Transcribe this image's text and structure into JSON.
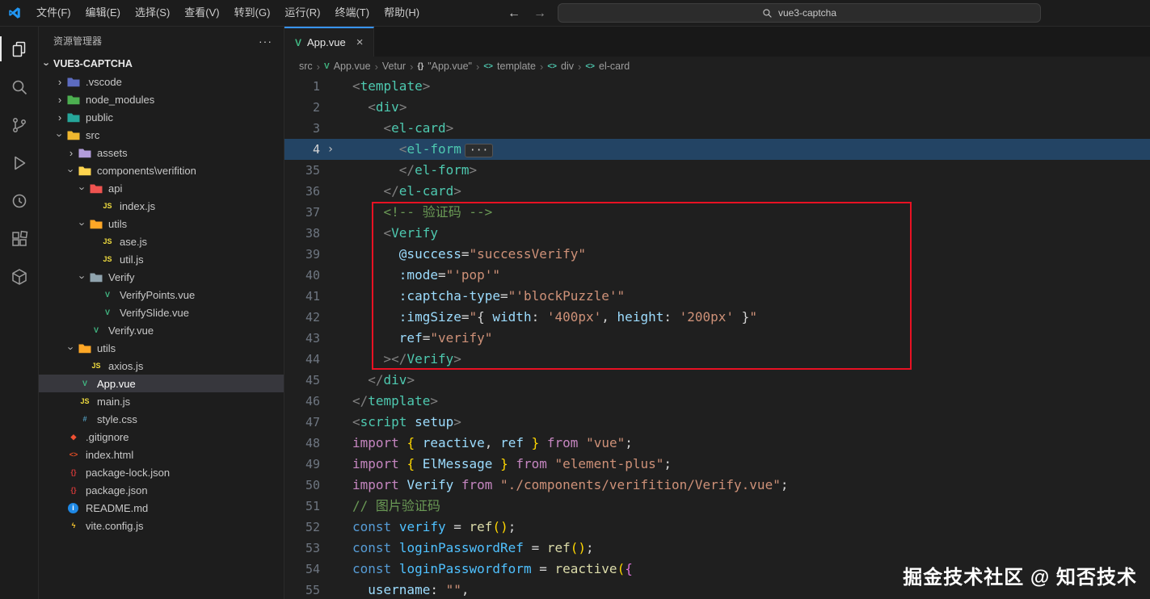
{
  "title_bar": {
    "menus": [
      "文件(F)",
      "编辑(E)",
      "选择(S)",
      "查看(V)",
      "转到(G)",
      "运行(R)",
      "终端(T)",
      "帮助(H)"
    ],
    "back_arrow": "←",
    "forward_arrow": "→",
    "search": {
      "value": "vue3-captcha"
    }
  },
  "activity_bar": {
    "items": [
      "explorer",
      "search",
      "source-control",
      "run-and-debug",
      "remote-explorer",
      "extensions",
      "container"
    ]
  },
  "sidebar": {
    "header": {
      "title": "资源管理器",
      "more": "···"
    },
    "root": {
      "label": "VUE3-CAPTCHA"
    },
    "tree": [
      {
        "label": ".vscode",
        "depth": 1,
        "type": "folder",
        "state": "collapsed",
        "color": "#5c6bc0"
      },
      {
        "label": "node_modules",
        "depth": 1,
        "type": "folder",
        "state": "collapsed",
        "color": "#4caf50"
      },
      {
        "label": "public",
        "depth": 1,
        "type": "folder",
        "state": "collapsed",
        "color": "#26a69a"
      },
      {
        "label": "src",
        "depth": 1,
        "type": "folder",
        "state": "expanded",
        "color": "#f0b72f"
      },
      {
        "label": "assets",
        "depth": 2,
        "type": "folder",
        "state": "collapsed",
        "color": "#b39ddb"
      },
      {
        "label": "components\\verifition",
        "depth": 2,
        "type": "folder",
        "state": "expanded",
        "color": "#ffd54f"
      },
      {
        "label": "api",
        "depth": 3,
        "type": "folder",
        "state": "expanded",
        "color": "#ef5350"
      },
      {
        "label": "index.js",
        "depth": 4,
        "type": "file",
        "icon": {
          "name": "javascript",
          "glyph": "JS",
          "fg": "#f1dd3f"
        }
      },
      {
        "label": "utils",
        "depth": 3,
        "type": "folder",
        "state": "expanded",
        "color": "#ffa726"
      },
      {
        "label": "ase.js",
        "depth": 4,
        "type": "file",
        "icon": {
          "name": "javascript",
          "glyph": "JS",
          "fg": "#f1dd3f"
        }
      },
      {
        "label": "util.js",
        "depth": 4,
        "type": "file",
        "icon": {
          "name": "javascript",
          "glyph": "JS",
          "fg": "#f1dd3f"
        }
      },
      {
        "label": "Verify",
        "depth": 3,
        "type": "folder",
        "state": "expanded",
        "color": "#90a4ae"
      },
      {
        "label": "VerifyPoints.vue",
        "depth": 4,
        "type": "file",
        "icon": {
          "name": "vue",
          "glyph": "V",
          "fg": "#41b883"
        }
      },
      {
        "label": "VerifySlide.vue",
        "depth": 4,
        "type": "file",
        "icon": {
          "name": "vue",
          "glyph": "V",
          "fg": "#41b883"
        }
      },
      {
        "label": "Verify.vue",
        "depth": 3,
        "type": "file",
        "icon": {
          "name": "vue",
          "glyph": "V",
          "fg": "#41b883"
        }
      },
      {
        "label": "utils",
        "depth": 2,
        "type": "folder",
        "state": "expanded",
        "color": "#ffa726"
      },
      {
        "label": "axios.js",
        "depth": 3,
        "type": "file",
        "icon": {
          "name": "javascript",
          "glyph": "JS",
          "fg": "#f1dd3f"
        }
      },
      {
        "label": "App.vue",
        "depth": 2,
        "type": "file",
        "selected": true,
        "icon": {
          "name": "vue",
          "glyph": "V",
          "fg": "#41b883"
        }
      },
      {
        "label": "main.js",
        "depth": 2,
        "type": "file",
        "icon": {
          "name": "javascript",
          "glyph": "JS",
          "fg": "#f1dd3f"
        }
      },
      {
        "label": "style.css",
        "depth": 2,
        "type": "file",
        "icon": {
          "name": "css",
          "glyph": "#",
          "fg": "#519aba"
        }
      },
      {
        "label": ".gitignore",
        "depth": 1,
        "type": "file",
        "icon": {
          "name": "git",
          "glyph": "◆",
          "fg": "#f05133"
        }
      },
      {
        "label": "index.html",
        "depth": 1,
        "type": "file",
        "icon": {
          "name": "html",
          "glyph": "<>",
          "fg": "#e44d26"
        }
      },
      {
        "label": "package-lock.json",
        "depth": 1,
        "type": "file",
        "icon": {
          "name": "npm",
          "glyph": "{}",
          "fg": "#cb3837"
        }
      },
      {
        "label": "package.json",
        "depth": 1,
        "type": "file",
        "icon": {
          "name": "npm",
          "glyph": "{}",
          "fg": "#cb3837"
        }
      },
      {
        "label": "README.md",
        "depth": 1,
        "type": "file",
        "icon": {
          "name": "readme",
          "glyph": "i",
          "fg": "#ffffff",
          "bg": "#1e88e5"
        }
      },
      {
        "label": "vite.config.js",
        "depth": 1,
        "type": "file",
        "icon": {
          "name": "vite",
          "glyph": "ϟ",
          "fg": "#ffcb2d"
        }
      }
    ]
  },
  "editor": {
    "tab": {
      "label": "App.vue",
      "close": "×"
    },
    "breadcrumbs": [
      {
        "label": "src"
      },
      {
        "label": "App.vue",
        "icon": "vue"
      },
      {
        "label": "Vetur"
      },
      {
        "label": "\"App.vue\"",
        "icon": "braces"
      },
      {
        "label": "template",
        "icon": "tag"
      },
      {
        "label": "div",
        "icon": "tag"
      },
      {
        "label": "el-card",
        "icon": "tag"
      }
    ],
    "annotation_box": {
      "color": "#e81123"
    },
    "watermark": "掘金技术社区 @ 知否技术",
    "code": {
      "lines": [
        {
          "num": 1,
          "tokens": [
            [
              "brk",
              "<"
            ],
            [
              "tag",
              "template"
            ],
            [
              "brk",
              ">"
            ]
          ]
        },
        {
          "num": 2,
          "tokens": [
            [
              "txt",
              "  "
            ],
            [
              "brk",
              "<"
            ],
            [
              "tag",
              "div"
            ],
            [
              "brk",
              ">"
            ]
          ]
        },
        {
          "num": 3,
          "tokens": [
            [
              "txt",
              "    "
            ],
            [
              "brk",
              "<"
            ],
            [
              "tag",
              "el-card"
            ],
            [
              "brk",
              ">"
            ]
          ]
        },
        {
          "num": 4,
          "fold": true,
          "highlight": true,
          "tokens": [
            [
              "txt",
              "      "
            ],
            [
              "brk",
              "<"
            ],
            [
              "tag",
              "el-form"
            ],
            [
              "fold",
              "···"
            ]
          ]
        },
        {
          "num": 35,
          "tokens": [
            [
              "txt",
              "      "
            ],
            [
              "brk",
              "</"
            ],
            [
              "tag",
              "el-form"
            ],
            [
              "brk",
              ">"
            ]
          ]
        },
        {
          "num": 36,
          "tokens": [
            [
              "txt",
              "    "
            ],
            [
              "brk",
              "</"
            ],
            [
              "tag",
              "el-card"
            ],
            [
              "brk",
              ">"
            ]
          ]
        },
        {
          "num": 37,
          "tokens": [
            [
              "txt",
              "    "
            ],
            [
              "cmt",
              "<!-- 验证码 -->"
            ]
          ]
        },
        {
          "num": 38,
          "tokens": [
            [
              "txt",
              "    "
            ],
            [
              "brk",
              "<"
            ],
            [
              "tag",
              "Verify"
            ]
          ]
        },
        {
          "num": 39,
          "tokens": [
            [
              "txt",
              "      "
            ],
            [
              "attr",
              "@success"
            ],
            [
              "pun",
              "="
            ],
            [
              "str",
              "\"successVerify\""
            ]
          ]
        },
        {
          "num": 40,
          "tokens": [
            [
              "txt",
              "      "
            ],
            [
              "attr",
              ":mode"
            ],
            [
              "pun",
              "="
            ],
            [
              "str",
              "\"'pop'\""
            ]
          ]
        },
        {
          "num": 41,
          "tokens": [
            [
              "txt",
              "      "
            ],
            [
              "attr",
              ":captcha-type"
            ],
            [
              "pun",
              "="
            ],
            [
              "str",
              "\"'blockPuzzle'\""
            ]
          ]
        },
        {
          "num": 42,
          "tokens": [
            [
              "txt",
              "      "
            ],
            [
              "attr",
              ":imgSize"
            ],
            [
              "pun",
              "="
            ],
            [
              "str",
              "\""
            ],
            [
              "pun",
              "{ "
            ],
            [
              "var",
              "width"
            ],
            [
              "pun",
              ": "
            ],
            [
              "str",
              "'400px'"
            ],
            [
              "pun",
              ", "
            ],
            [
              "var",
              "height"
            ],
            [
              "pun",
              ": "
            ],
            [
              "str",
              "'200px'"
            ],
            [
              "pun",
              " }"
            ],
            [
              "str",
              "\""
            ]
          ]
        },
        {
          "num": 43,
          "tokens": [
            [
              "txt",
              "      "
            ],
            [
              "attr",
              "ref"
            ],
            [
              "pun",
              "="
            ],
            [
              "str",
              "\"verify\""
            ]
          ]
        },
        {
          "num": 44,
          "tokens": [
            [
              "txt",
              "    "
            ],
            [
              "brk",
              "></"
            ],
            [
              "tag",
              "Verify"
            ],
            [
              "brk",
              ">"
            ]
          ]
        },
        {
          "num": 45,
          "tokens": [
            [
              "txt",
              "  "
            ],
            [
              "brk",
              "</"
            ],
            [
              "tag",
              "div"
            ],
            [
              "brk",
              ">"
            ]
          ]
        },
        {
          "num": 46,
          "tokens": [
            [
              "brk",
              "</"
            ],
            [
              "tag",
              "template"
            ],
            [
              "brk",
              ">"
            ]
          ]
        },
        {
          "num": 47,
          "tokens": [
            [
              "brk",
              "<"
            ],
            [
              "tag",
              "script"
            ],
            [
              "txt",
              " "
            ],
            [
              "attr",
              "setup"
            ],
            [
              "brk",
              ">"
            ]
          ]
        },
        {
          "num": 48,
          "tokens": [
            [
              "kw",
              "import"
            ],
            [
              "txt",
              " "
            ],
            [
              "brace",
              "{"
            ],
            [
              "txt",
              " "
            ],
            [
              "var",
              "reactive"
            ],
            [
              "pun",
              ","
            ],
            [
              "txt",
              " "
            ],
            [
              "var",
              "ref"
            ],
            [
              "txt",
              " "
            ],
            [
              "brace",
              "}"
            ],
            [
              "txt",
              " "
            ],
            [
              "kw",
              "from"
            ],
            [
              "txt",
              " "
            ],
            [
              "str",
              "\"vue\""
            ],
            [
              "pun",
              ";"
            ]
          ]
        },
        {
          "num": 49,
          "tokens": [
            [
              "kw",
              "import"
            ],
            [
              "txt",
              " "
            ],
            [
              "brace",
              "{"
            ],
            [
              "txt",
              " "
            ],
            [
              "var",
              "ElMessage"
            ],
            [
              "txt",
              " "
            ],
            [
              "brace",
              "}"
            ],
            [
              "txt",
              " "
            ],
            [
              "kw",
              "from"
            ],
            [
              "txt",
              " "
            ],
            [
              "str",
              "\"element-plus\""
            ],
            [
              "pun",
              ";"
            ]
          ]
        },
        {
          "num": 50,
          "tokens": [
            [
              "kw",
              "import"
            ],
            [
              "txt",
              " "
            ],
            [
              "var",
              "Verify"
            ],
            [
              "txt",
              " "
            ],
            [
              "kw",
              "from"
            ],
            [
              "txt",
              " "
            ],
            [
              "str",
              "\"./components/verifition/Verify.vue\""
            ],
            [
              "pun",
              ";"
            ]
          ]
        },
        {
          "num": 51,
          "tokens": [
            [
              "cmt",
              "// 图片验证码"
            ]
          ]
        },
        {
          "num": 52,
          "tokens": [
            [
              "kw2",
              "const"
            ],
            [
              "txt",
              " "
            ],
            [
              "var2",
              "verify"
            ],
            [
              "txt",
              " "
            ],
            [
              "pun",
              "="
            ],
            [
              "txt",
              " "
            ],
            [
              "fn",
              "ref"
            ],
            [
              "brace",
              "()"
            ],
            [
              "pun",
              ";"
            ]
          ]
        },
        {
          "num": 53,
          "tokens": [
            [
              "kw2",
              "const"
            ],
            [
              "txt",
              " "
            ],
            [
              "var2",
              "loginPasswordRef"
            ],
            [
              "txt",
              " "
            ],
            [
              "pun",
              "="
            ],
            [
              "txt",
              " "
            ],
            [
              "fn",
              "ref"
            ],
            [
              "brace",
              "()"
            ],
            [
              "pun",
              ";"
            ]
          ]
        },
        {
          "num": 54,
          "tokens": [
            [
              "kw2",
              "const"
            ],
            [
              "txt",
              " "
            ],
            [
              "var2",
              "loginPasswordform"
            ],
            [
              "txt",
              " "
            ],
            [
              "pun",
              "="
            ],
            [
              "txt",
              " "
            ],
            [
              "fn",
              "reactive"
            ],
            [
              "brace",
              "("
            ],
            [
              "brace2",
              "{"
            ]
          ]
        },
        {
          "num": 55,
          "tokens": [
            [
              "txt",
              "  "
            ],
            [
              "var",
              "username"
            ],
            [
              "pun",
              ":"
            ],
            [
              "txt",
              " "
            ],
            [
              "str",
              "\"\""
            ],
            [
              "pun",
              ","
            ]
          ]
        }
      ]
    }
  }
}
